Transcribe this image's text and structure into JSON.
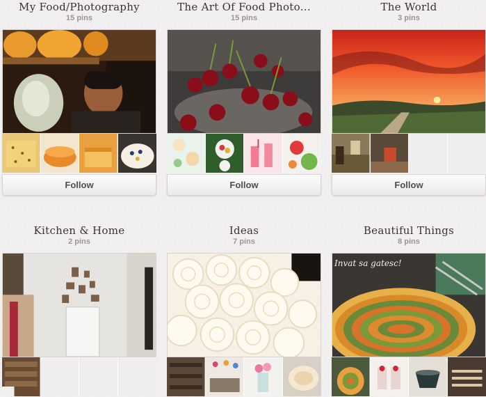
{
  "boards": [
    {
      "title": "My Food/Photography",
      "count": "15 pins",
      "follow": "Follow"
    },
    {
      "title": "The Art Of Food Photo...",
      "count": "15 pins",
      "follow": "Follow"
    },
    {
      "title": "The World",
      "count": "3 pins",
      "follow": "Follow"
    },
    {
      "title": "Kitchen & Home",
      "count": "2 pins"
    },
    {
      "title": "Ideas",
      "count": "7 pins"
    },
    {
      "title": "Beautiful Things",
      "count": "8 pins",
      "cover_caption": "Invat sa gatesc!"
    }
  ]
}
